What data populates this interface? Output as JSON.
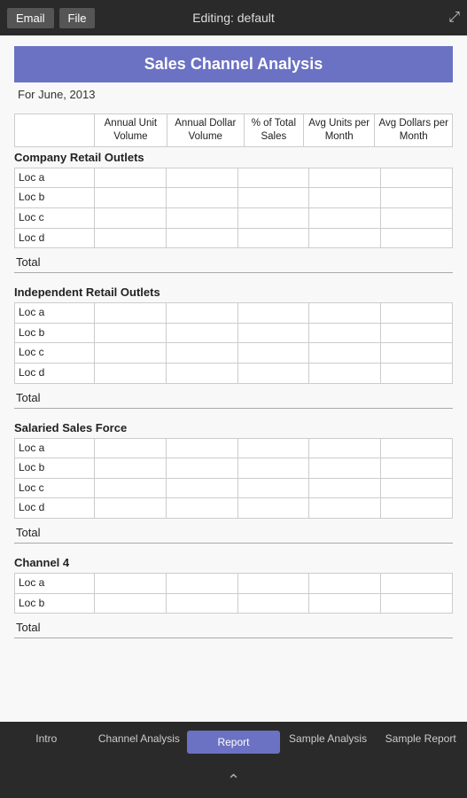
{
  "topBar": {
    "emailBtn": "Email",
    "fileBtn": "File",
    "title": "Editing: default",
    "expandIcon": "⤢"
  },
  "page": {
    "title": "Sales Channel Analysis",
    "subtitle": "For June, 2013"
  },
  "tableHeaders": [
    "Annual Unit Volume",
    "Annual Dollar Volume",
    "% of Total Sales",
    "Avg Units per Month",
    "Avg Dollars per Month"
  ],
  "sections": [
    {
      "title": "Company Retail Outlets",
      "rows": [
        "Loc a",
        "Loc b",
        "Loc c",
        "Loc d"
      ],
      "totalLabel": "Total"
    },
    {
      "title": "Independent Retail Outlets",
      "rows": [
        "Loc a",
        "Loc b",
        "Loc c",
        "Loc d"
      ],
      "totalLabel": "Total"
    },
    {
      "title": "Salaried Sales Force",
      "rows": [
        "Loc a",
        "Loc b",
        "Loc c",
        "Loc d"
      ],
      "totalLabel": "Total"
    },
    {
      "title": "Channel 4",
      "rows": [
        "Loc a",
        "Loc b"
      ],
      "totalLabel": "Total"
    }
  ],
  "bottomNav": {
    "tabs": [
      {
        "label": "Intro",
        "active": false
      },
      {
        "label": "Channel Analysis",
        "active": false
      },
      {
        "label": "Report",
        "active": true
      },
      {
        "label": "Sample Analysis",
        "active": false
      },
      {
        "label": "Sample Report",
        "active": false
      }
    ]
  },
  "bottomHandle": {
    "arrowIcon": "⌃"
  }
}
